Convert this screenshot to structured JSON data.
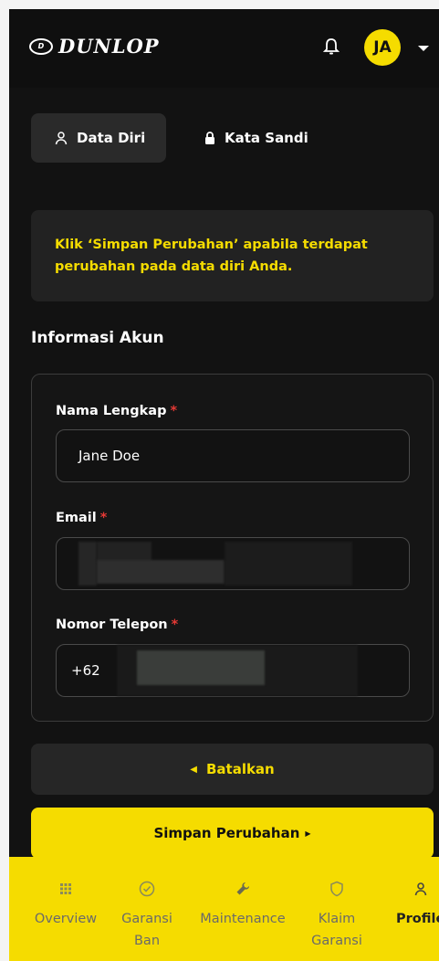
{
  "header": {
    "brand": "DUNLOP",
    "brand_mark": "D",
    "avatar_initials": "JA"
  },
  "tabs": [
    {
      "label": "Data Diri",
      "icon": "user-icon",
      "active": true
    },
    {
      "label": "Kata Sandi",
      "icon": "lock-icon",
      "active": false
    }
  ],
  "notice": {
    "text": "Klik ‘Simpan Perubahan’ apabila terdapat perubahan pada data diri Anda."
  },
  "section_title": "Informasi Akun",
  "form": {
    "required_mark": "*",
    "name": {
      "label": "Nama Lengkap",
      "value": "Jane Doe"
    },
    "email": {
      "label": "Email",
      "value": ""
    },
    "phone": {
      "label": "Nomor Telepon",
      "prefix": "+62",
      "value": ""
    }
  },
  "buttons": {
    "cancel": "Batalkan",
    "save": "Simpan Perubahan"
  },
  "bottom_nav": [
    {
      "label": "Overview",
      "icon": "grid-icon",
      "active": false
    },
    {
      "label": "Garansi Ban",
      "icon": "check-circle-icon",
      "active": false
    },
    {
      "label": "Maintenance",
      "icon": "wrench-icon",
      "active": false
    },
    {
      "label": "Klaim Garansi",
      "icon": "shield-icon",
      "active": false
    },
    {
      "label": "Profile",
      "icon": "user-icon",
      "active": true
    }
  ],
  "colors": {
    "accent": "#f5dc00",
    "background": "#121212",
    "required": "#e53935"
  }
}
